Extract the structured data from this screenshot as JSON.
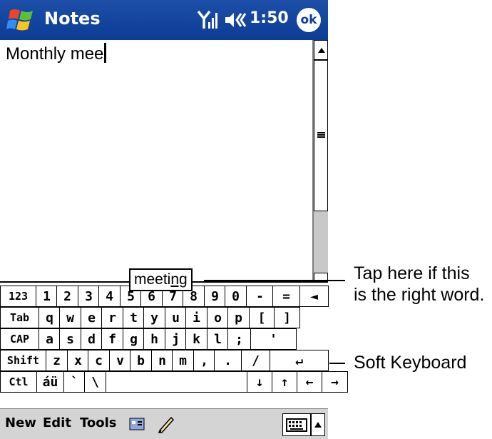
{
  "titlebar": {
    "app_title": "Notes",
    "time": "1:50",
    "ok_label": "ok"
  },
  "note": {
    "text": "Monthly mee"
  },
  "suggestion": {
    "prefix": "meeti",
    "underlined": "ng"
  },
  "keyboard": {
    "rows": [
      [
        "123",
        "1",
        "2",
        "3",
        "4",
        "5",
        "6",
        "7",
        "8",
        "9",
        "0",
        "-",
        "=",
        "◄"
      ],
      [
        "Tab",
        "q",
        "w",
        "e",
        "r",
        "t",
        "y",
        "u",
        "i",
        "o",
        "p",
        "[",
        "]"
      ],
      [
        "CAP",
        "a",
        "s",
        "d",
        "f",
        "g",
        "h",
        "j",
        "k",
        "l",
        ";",
        "'"
      ],
      [
        "Shift",
        "z",
        "x",
        "c",
        "v",
        "b",
        "n",
        "m",
        ",",
        ".",
        "/",
        "↵"
      ],
      [
        "Ctl",
        "áü",
        "`",
        "\\",
        "",
        "↓",
        "↑",
        "←",
        "→"
      ]
    ]
  },
  "menubar": {
    "new": "New",
    "edit": "Edit",
    "tools": "Tools"
  },
  "callouts": {
    "suggestion_line1": "Tap here if this",
    "suggestion_line2": "is the right word.",
    "keyboard": "Soft Keyboard"
  }
}
